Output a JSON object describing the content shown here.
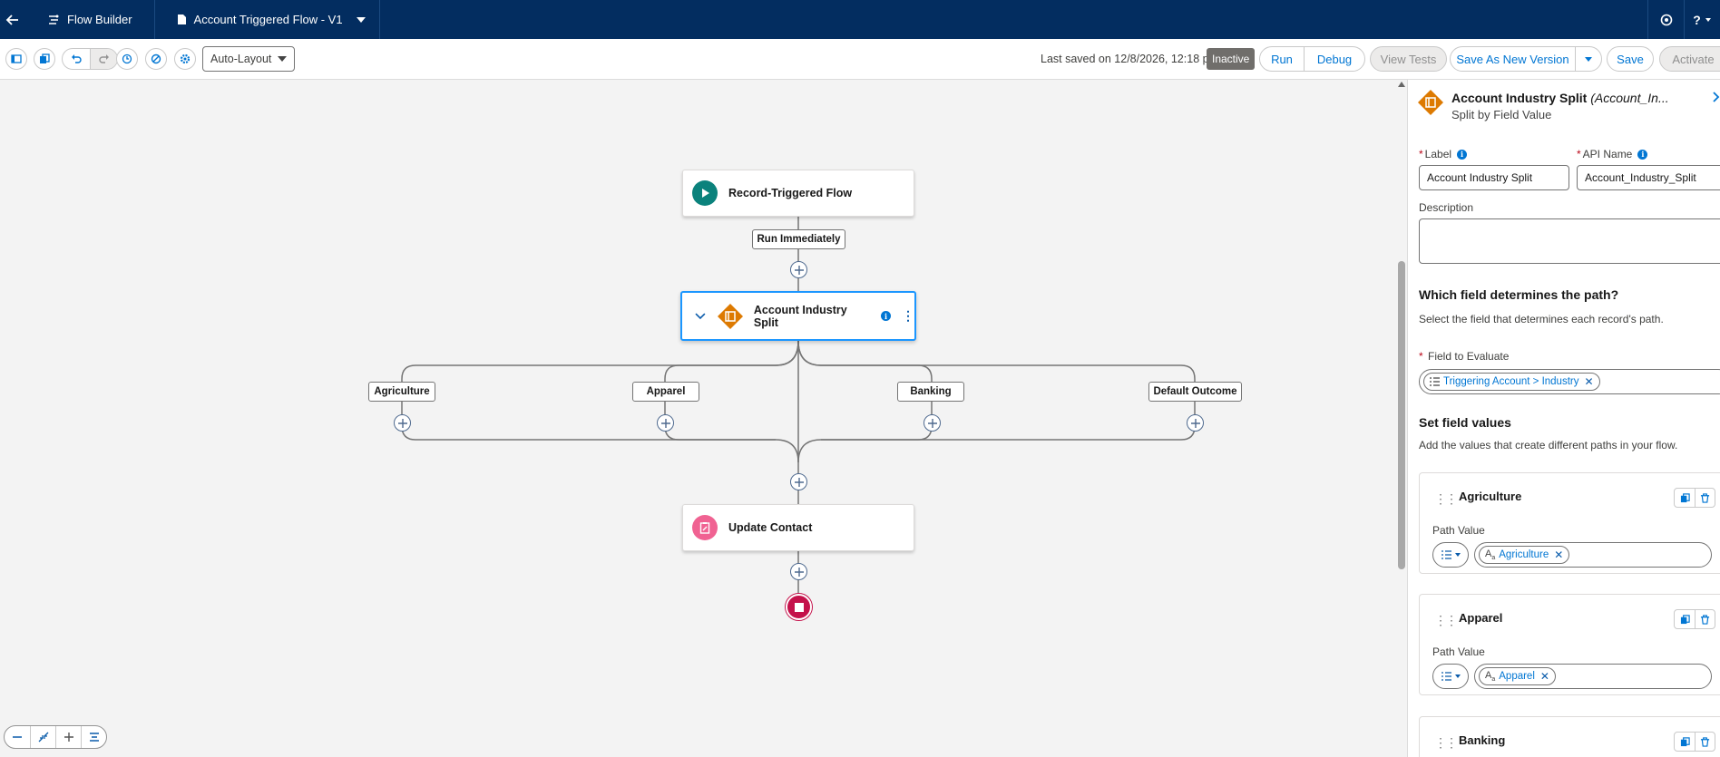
{
  "topnav": {
    "back_icon": "arrow-left-icon",
    "app_name": "Flow Builder",
    "file_name": "Account Triggered Flow - V1",
    "right_icons": [
      "setup-gear-icon",
      "help-icon"
    ],
    "help_label": "?"
  },
  "toolbar": {
    "layout_select": "Auto-Layout",
    "last_saved": "Last saved on 12/8/2026, 12:18 pm",
    "status_badge": "Inactive",
    "run_label": "Run",
    "debug_label": "Debug",
    "view_tests_label": "View Tests",
    "save_as_new_version_label": "Save As New Version",
    "save_label": "Save",
    "activate_label": "Activate"
  },
  "canvas": {
    "start_node": "Record-Triggered Flow",
    "run_label": "Run Immediately",
    "decision_node": "Account Industry Split",
    "branches": [
      "Agriculture",
      "Apparel",
      "Banking",
      "Default Outcome"
    ],
    "update_node": "Update Contact"
  },
  "panel": {
    "title": "Account Industry Split",
    "api_hint": "(Account_In...",
    "subtitle": "Split by Field Value",
    "label_label": "Label",
    "label_value": "Account Industry Split",
    "api_name_label": "API Name",
    "api_name_value": "Account_Industry_Split",
    "description_label": "Description",
    "which_field_title": "Which field determines the path?",
    "which_field_text": "Select the field that determines each record's path.",
    "field_to_evaluate_label": "Field to Evaluate",
    "field_to_evaluate_value": "Triggering Account > Industry",
    "set_values_title": "Set field values",
    "set_values_text": "Add the values that create different paths in your flow.",
    "path_value_label": "Path Value",
    "cards": [
      {
        "title": "Agriculture",
        "value": "Agriculture"
      },
      {
        "title": "Apparel",
        "value": "Apparel"
      },
      {
        "title": "Banking",
        "value": ""
      }
    ]
  },
  "colors": {
    "nav_bg": "#032d60",
    "brand_blue": "#0176d3",
    "decision_orange": "#dd7a01",
    "start_teal": "#06a59a",
    "end_red": "#c23934",
    "update_pink": "#e3066a"
  }
}
